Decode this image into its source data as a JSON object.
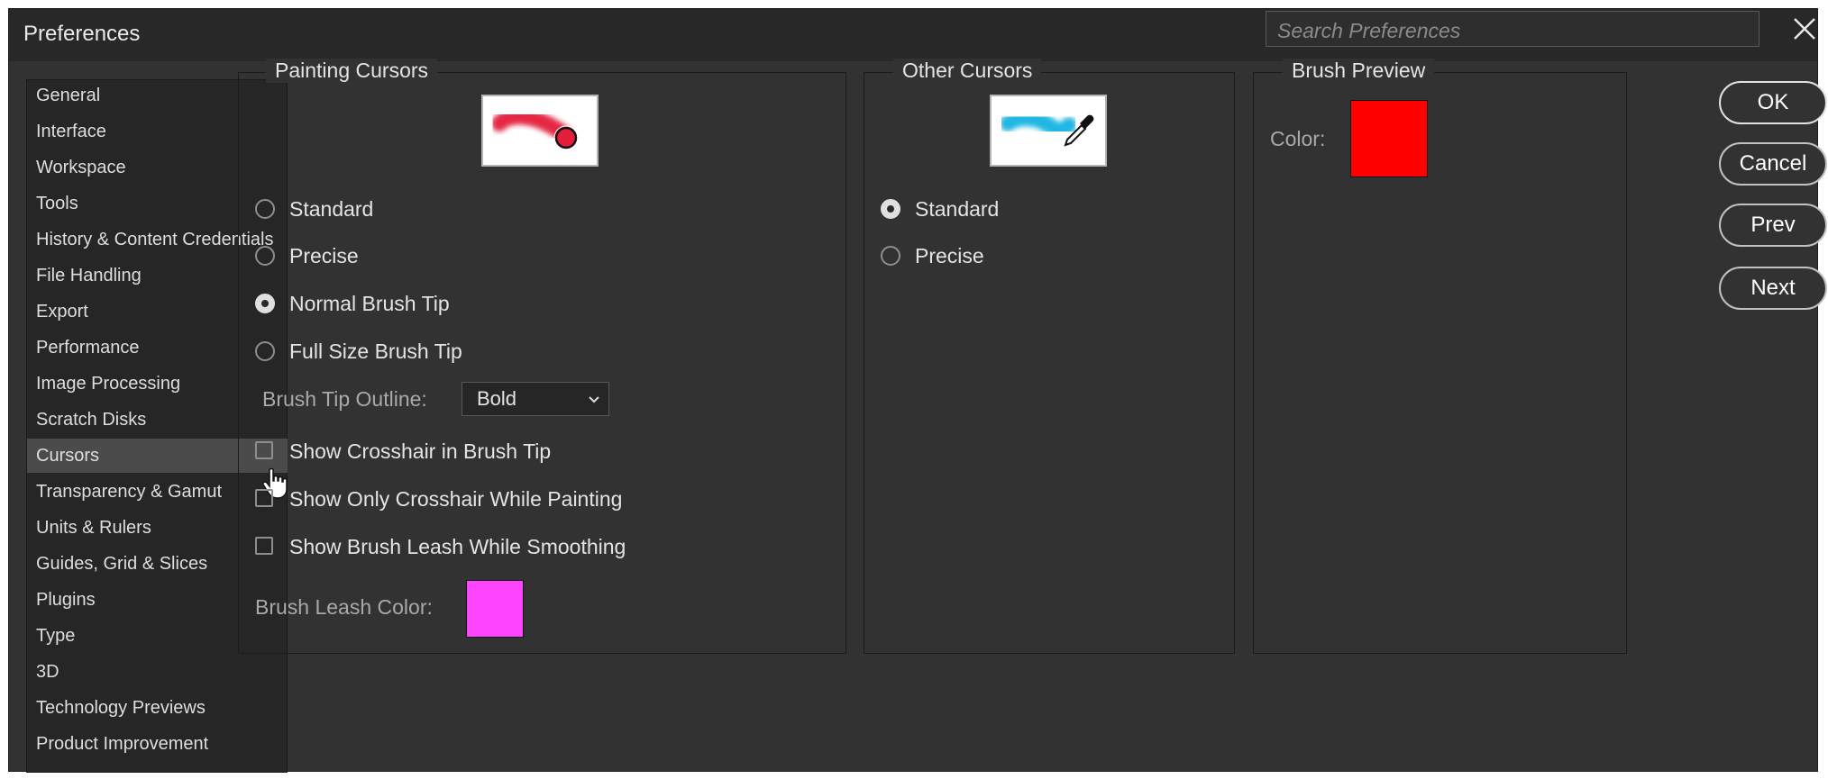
{
  "window": {
    "title": "Preferences",
    "search_placeholder": "Search Preferences"
  },
  "sidebar": {
    "items": [
      {
        "label": "General"
      },
      {
        "label": "Interface"
      },
      {
        "label": "Workspace"
      },
      {
        "label": "Tools"
      },
      {
        "label": "History & Content Credentials"
      },
      {
        "label": "File Handling"
      },
      {
        "label": "Export"
      },
      {
        "label": "Performance"
      },
      {
        "label": "Image Processing"
      },
      {
        "label": "Scratch Disks"
      },
      {
        "label": "Cursors"
      },
      {
        "label": "Transparency & Gamut"
      },
      {
        "label": "Units & Rulers"
      },
      {
        "label": "Guides, Grid & Slices"
      },
      {
        "label": "Plugins"
      },
      {
        "label": "Type"
      },
      {
        "label": "3D"
      },
      {
        "label": "Technology Previews"
      },
      {
        "label": "Product Improvement"
      }
    ],
    "selected": "Cursors"
  },
  "painting_cursors": {
    "title": "Painting Cursors",
    "options": [
      {
        "label": "Standard",
        "selected": false
      },
      {
        "label": "Precise",
        "selected": false
      },
      {
        "label": "Normal Brush Tip",
        "selected": true
      },
      {
        "label": "Full Size Brush Tip",
        "selected": false
      }
    ],
    "brush_tip_outline_label": "Brush Tip Outline:",
    "brush_tip_outline_value": "Bold",
    "checkboxes": [
      {
        "label": "Show Crosshair in Brush Tip",
        "checked": false
      },
      {
        "label": "Show Only Crosshair While Painting",
        "checked": false
      },
      {
        "label": "Show Brush Leash While Smoothing",
        "checked": false
      }
    ],
    "leash_color_label": "Brush Leash Color:",
    "leash_color": "#ff44ff"
  },
  "other_cursors": {
    "title": "Other Cursors",
    "options": [
      {
        "label": "Standard",
        "selected": true
      },
      {
        "label": "Precise",
        "selected": false
      }
    ]
  },
  "brush_preview": {
    "title": "Brush Preview",
    "color_label": "Color:",
    "color": "#ff0000"
  },
  "buttons": {
    "ok": "OK",
    "cancel": "Cancel",
    "prev": "Prev",
    "next": "Next"
  },
  "icons": {
    "close": "close-icon",
    "dropdown": "chevron-down-icon",
    "pointer": "hand-pointer-icon",
    "painting_preview": "brush-stroke-preview-icon",
    "eyedropper_preview": "eyedropper-preview-icon"
  }
}
